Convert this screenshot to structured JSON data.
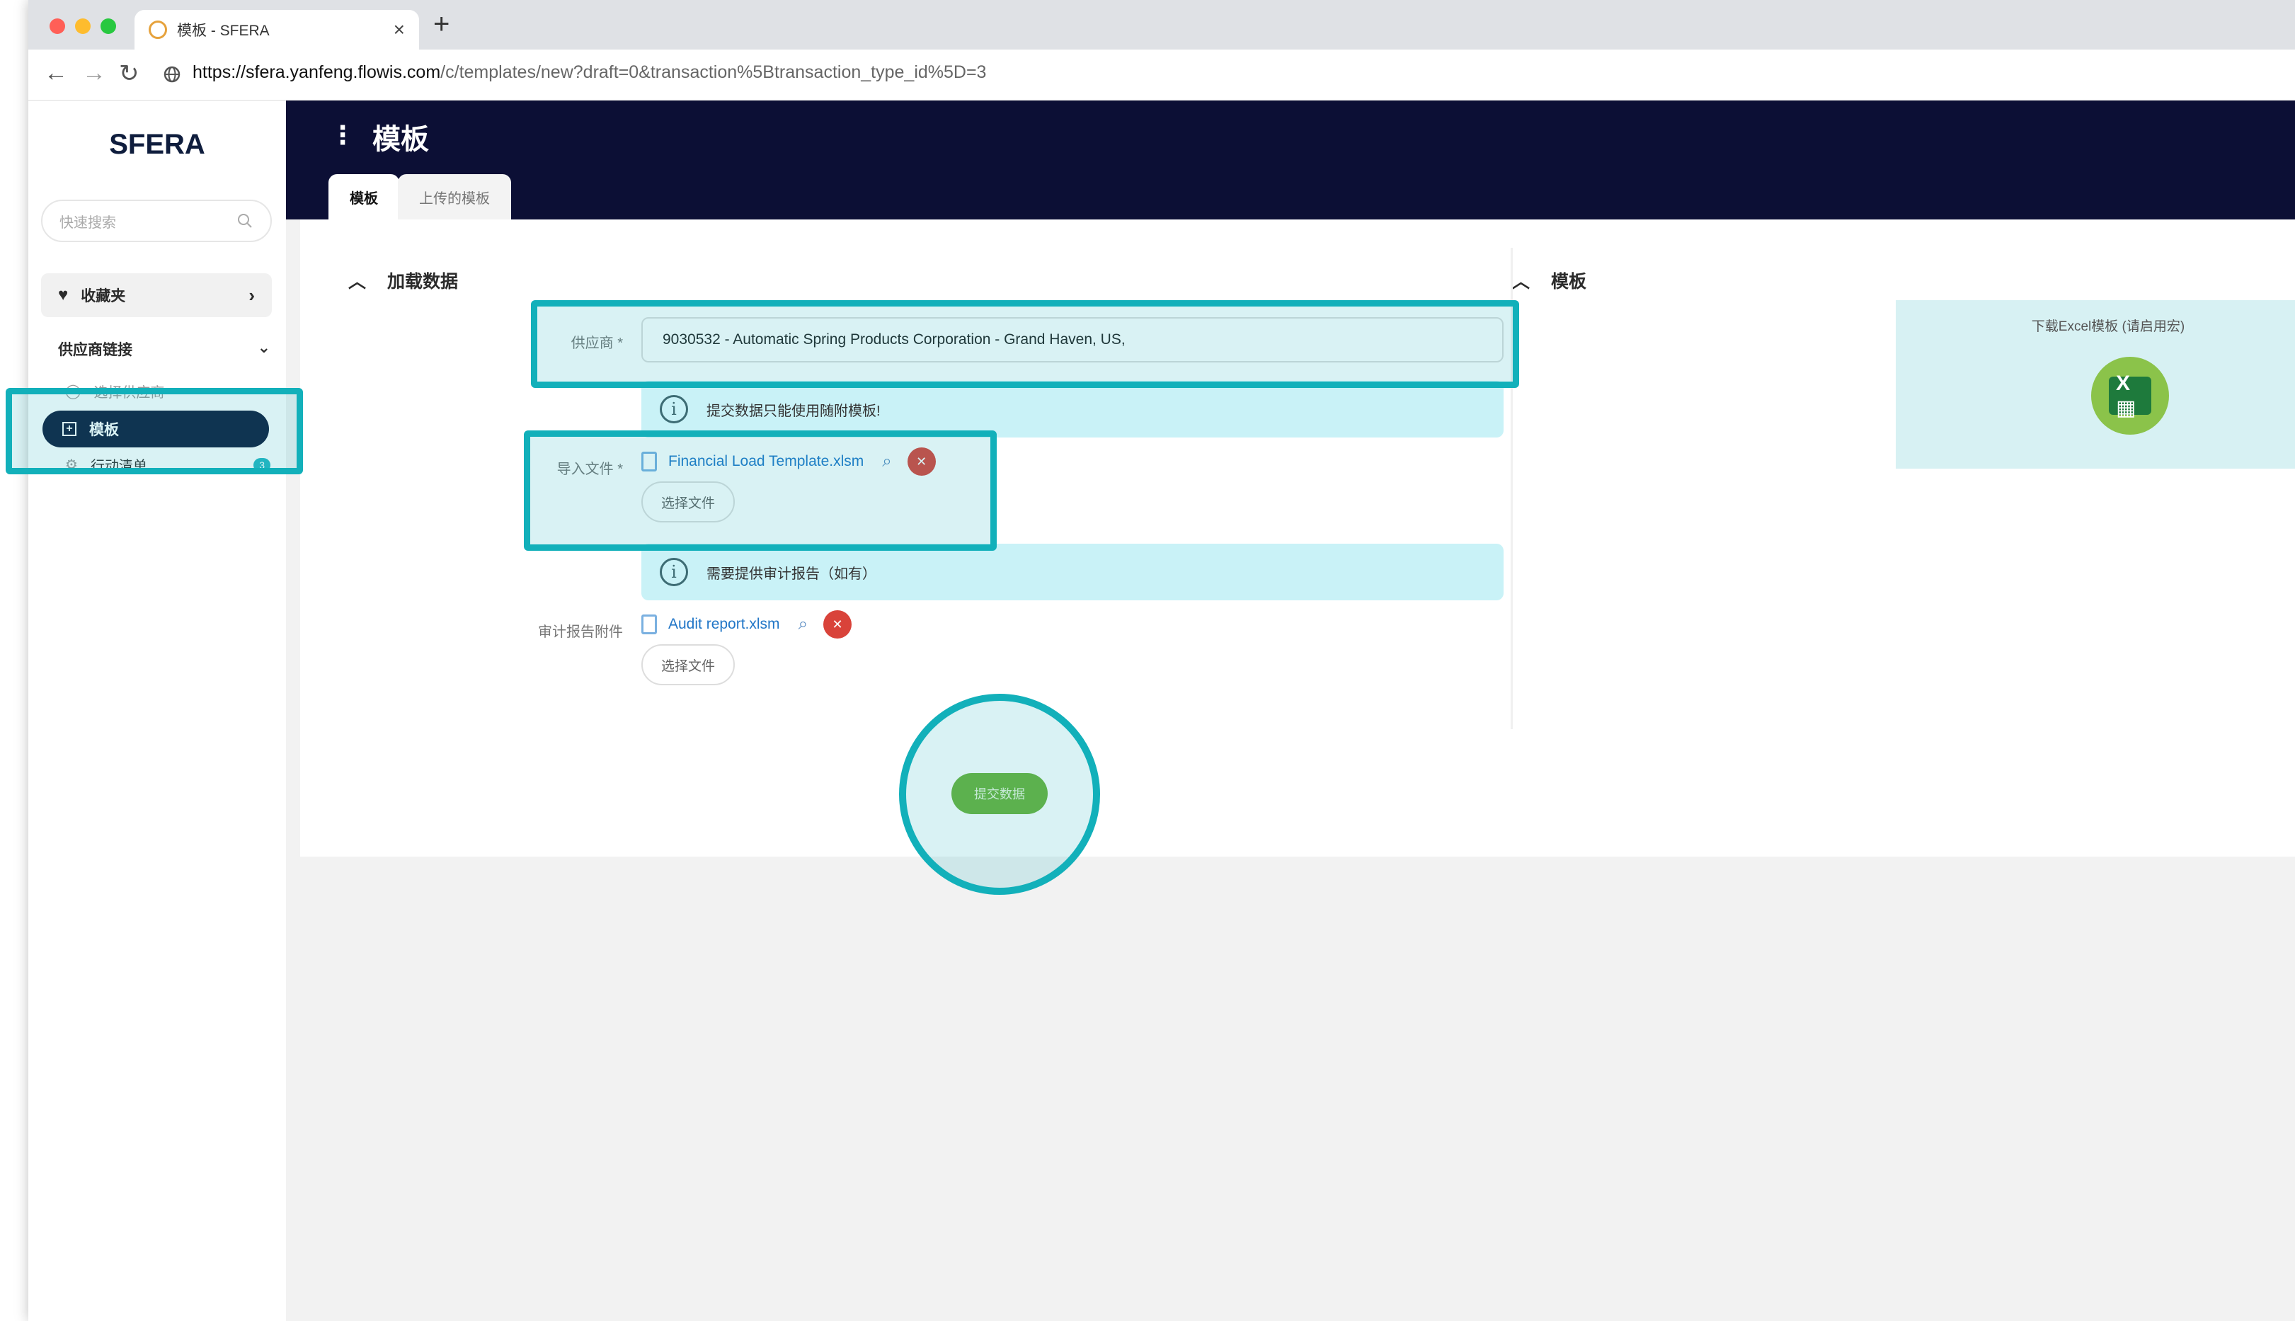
{
  "browser": {
    "tab_title": "模板 - SFERA",
    "tab_close": "×",
    "new_tab": "+",
    "url_host": "https://sfera.yanfeng.flowis.com",
    "url_path": "/c/templates/new?draft=0&transaction%5Btransaction_type_id%5D=3",
    "back": "←",
    "forward": "→",
    "reload": "↻"
  },
  "sidebar": {
    "logo": "SFERA",
    "search_placeholder": "快速搜索",
    "favorites": "收藏夹",
    "group": "供应商链接",
    "items": [
      {
        "label": "选择供应商"
      },
      {
        "label": "模板"
      },
      {
        "label": "行动清单",
        "badge": "3"
      }
    ]
  },
  "header": {
    "title": "模板",
    "tabs": [
      {
        "label": "模板"
      },
      {
        "label": "上传的模板"
      }
    ]
  },
  "main": {
    "section_left": "加载数据",
    "section_right": "模板",
    "supplier_label": "供应商 *",
    "supplier_value": "9030532 - Automatic Spring Products Corporation - Grand Haven, US,",
    "info1": "提交数据只能使用随附模板!",
    "import_label": "导入文件 *",
    "import_file": "Financial Load Template.xlsm",
    "choose_file": "选择文件",
    "info2": "需要提供审计报告（如有）",
    "audit_label": "审计报告附件",
    "audit_file": "Audit report.xlsm",
    "submit": "提交数据",
    "download_label": "下载Excel模板 (请启用宏)"
  },
  "colors": {
    "highlight": "#12b0ba",
    "header_bg": "#0c0f35",
    "info_bg": "#c9f2f7",
    "submit_green": "#6ab23a",
    "delete_red": "#d9433a"
  }
}
